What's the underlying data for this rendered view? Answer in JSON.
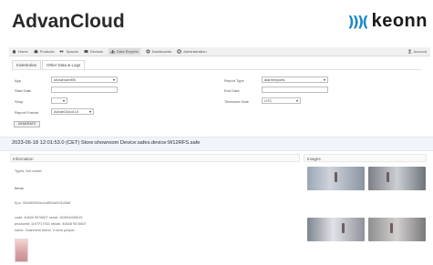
{
  "header": {
    "title": "AdvanCloud",
    "brand_name": "keonn",
    "brand_mark": ")))("
  },
  "nav": {
    "items": [
      {
        "label": "Home",
        "icon": "home-icon"
      },
      {
        "label": "Products",
        "icon": "products-icon"
      },
      {
        "label": "Spaces",
        "icon": "spaces-icon"
      },
      {
        "label": "Devices",
        "icon": "devices-icon"
      },
      {
        "label": "Data Reports",
        "icon": "data-reports-icon"
      },
      {
        "label": "Dashboards",
        "icon": "dashboards-icon"
      },
      {
        "label": "Administration",
        "icon": "administration-icon"
      }
    ],
    "account": "Account"
  },
  "tabs": [
    "Inventories",
    "Other Data & Logs"
  ],
  "form": {
    "app_label": "App",
    "app_value": "showroomEB",
    "start_date_label": "Start Date",
    "shop_label": "Shop",
    "report_format_label": "Report Format",
    "report_format_value": "AdvanCloud UI",
    "report_type_label": "Report Type",
    "report_type_value": "alarmreports",
    "end_date_label": "End Date",
    "timezone_label": "Timezone Date",
    "timezone_value": "UTC",
    "generate_label": "GENERATE"
  },
  "store_title": "2023-06-18 12:01:53.0 (CET) Store:showroom Device:safes.device:W12RFS.safe",
  "info": {
    "heading": "Information",
    "types_line": "Types: Not coded",
    "items_heading": "Items",
    "epc": "Epc: 303469934ec1b892a8191c6b8",
    "code_line": "code: 40640 9076607 serial: 102694439019",
    "product_line": "productId: 1197F17921 ebsdk: 40648 9076607",
    "name_line": "name: Cashmere blend. V-neck jumper"
  },
  "images": {
    "heading": "Images"
  }
}
